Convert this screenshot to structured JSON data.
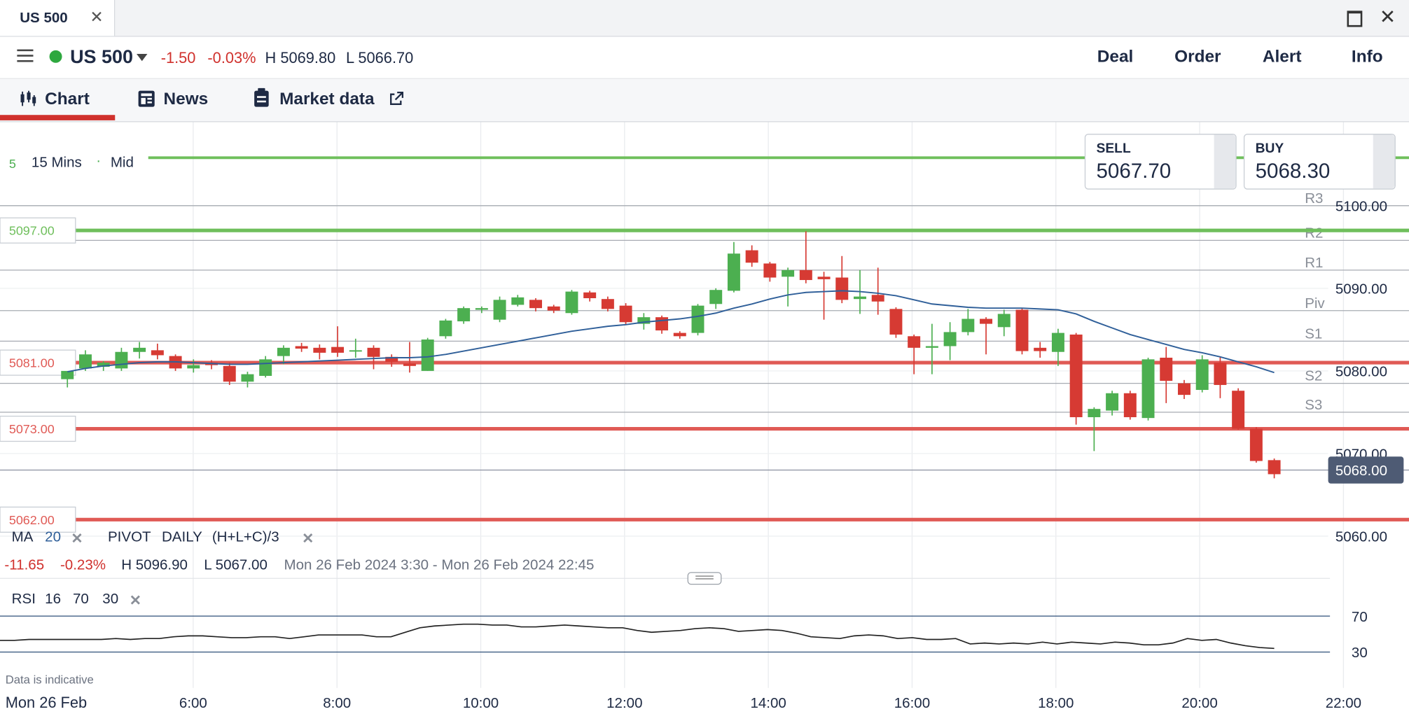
{
  "window": {
    "tab_title": "US 500",
    "close_icon": "close-icon",
    "maximize_icon": "maximize-icon"
  },
  "instrument": {
    "name": "US 500",
    "change": "-1.50",
    "change_pct": "-0.03%",
    "high": "H 5069.80",
    "low": "L 5066.70",
    "status_color": "#2ea83f"
  },
  "actions": [
    "Deal",
    "Order",
    "Alert",
    "Info"
  ],
  "tabs": [
    {
      "label": "Chart",
      "icon": "candlestick-chart-icon",
      "active": true
    },
    {
      "label": "News",
      "icon": "newspaper-icon",
      "active": false
    },
    {
      "label": "Market data",
      "icon": "clipboard-icon",
      "active": false,
      "trailing_icon": "external-link-icon"
    }
  ],
  "toolbar": {
    "interval_prefix": "5",
    "interval": "15 Mins",
    "price_type": "Mid"
  },
  "quotes": {
    "sell": {
      "label": "SELL",
      "price": "5067.70"
    },
    "buy": {
      "label": "BUY",
      "price": "5068.30"
    }
  },
  "indicators": {
    "ma": {
      "name": "MA",
      "period": "20"
    },
    "pivot": {
      "name": "PIVOT",
      "period": "DAILY",
      "formula": "(H+L+C)/3"
    },
    "rsi": {
      "name": "RSI",
      "period": "16",
      "upper": "70",
      "lower": "30"
    }
  },
  "summary": {
    "change": "-11.65",
    "change_pct": "-0.23%",
    "high": "H 5096.90",
    "low": "L 5067.00",
    "range": "Mon 26 Feb 2024 3:30 - Mon 26 Feb 2024 22:45"
  },
  "disclaimer": "Data is indicative",
  "chart_data": {
    "type": "candlestick",
    "date_label": "Mon 26 Feb",
    "x_ticks": [
      "6:00",
      "8:00",
      "10:00",
      "12:00",
      "14:00",
      "16:00",
      "18:00",
      "20:00",
      "22:00"
    ],
    "y_ticks": [
      "5100.00",
      "5090.00",
      "5080.00",
      "5070.00",
      "5060.00"
    ],
    "ylim": [
      5058,
      5110
    ],
    "current_price": "5068.00",
    "candles": [
      [
        5079.0,
        5080.0,
        5078.0,
        5079.5
      ],
      [
        5080.3,
        5082.0,
        5080.0,
        5082.5
      ],
      [
        5080.5,
        5081.0,
        5080.0,
        5081.2
      ],
      [
        5080.3,
        5082.3,
        5080.0,
        5082.8
      ],
      [
        5082.3,
        5082.8,
        5081.5,
        5083.5
      ],
      [
        5082.5,
        5081.9,
        5081.4,
        5083.3
      ],
      [
        5081.8,
        5080.3,
        5080.0,
        5082.0
      ],
      [
        5080.3,
        5080.7,
        5079.8,
        5081.4
      ],
      [
        5081.0,
        5080.7,
        5080.2,
        5081.3
      ],
      [
        5080.6,
        5078.7,
        5078.3,
        5081.0
      ],
      [
        5078.7,
        5079.6,
        5078.0,
        5079.9
      ],
      [
        5079.4,
        5081.4,
        5079.2,
        5081.8
      ],
      [
        5081.8,
        5082.8,
        5080.8,
        5083.1
      ],
      [
        5083.0,
        5082.7,
        5082.3,
        5083.4
      ],
      [
        5082.8,
        5082.2,
        5081.4,
        5083.2
      ],
      [
        5082.9,
        5082.2,
        5081.7,
        5085.4
      ],
      [
        5082.4,
        5082.5,
        5081.6,
        5083.9
      ],
      [
        5082.8,
        5081.7,
        5080.2,
        5083.1
      ],
      [
        5081.7,
        5081.1,
        5080.5,
        5082.0
      ],
      [
        5080.9,
        5080.6,
        5079.8,
        5083.5
      ],
      [
        5080.0,
        5083.8,
        5080.0,
        5084.0
      ],
      [
        5084.2,
        5086.1,
        5083.9,
        5086.3
      ],
      [
        5086.0,
        5087.6,
        5085.7,
        5087.8
      ],
      [
        5087.4,
        5087.6,
        5087.0,
        5087.8
      ],
      [
        5086.2,
        5088.6,
        5085.9,
        5089.0
      ],
      [
        5088.0,
        5088.9,
        5087.8,
        5089.2
      ],
      [
        5088.6,
        5087.6,
        5087.2,
        5088.8
      ],
      [
        5087.8,
        5087.3,
        5087.0,
        5088.0
      ],
      [
        5087.0,
        5089.6,
        5086.8,
        5089.8
      ],
      [
        5089.5,
        5088.8,
        5088.4,
        5089.7
      ],
      [
        5088.7,
        5087.5,
        5087.2,
        5089.0
      ],
      [
        5087.9,
        5085.9,
        5085.6,
        5088.2
      ],
      [
        5085.7,
        5086.5,
        5085.0,
        5087.0
      ],
      [
        5086.5,
        5084.9,
        5084.5,
        5086.7
      ],
      [
        5084.6,
        5084.2,
        5083.9,
        5084.8
      ],
      [
        5084.6,
        5087.9,
        5084.3,
        5088.1
      ],
      [
        5088.1,
        5089.8,
        5087.5,
        5090.0
      ],
      [
        5089.7,
        5094.2,
        5089.5,
        5095.6
      ],
      [
        5094.6,
        5093.1,
        5092.6,
        5095.2
      ],
      [
        5093.0,
        5091.3,
        5090.8,
        5093.2
      ],
      [
        5091.4,
        5092.2,
        5087.8,
        5092.5
      ],
      [
        5092.2,
        5091.0,
        5090.6,
        5096.9
      ],
      [
        5091.4,
        5091.1,
        5086.2,
        5092.0
      ],
      [
        5091.3,
        5088.6,
        5088.2,
        5093.9
      ],
      [
        5088.7,
        5089.0,
        5086.9,
        5092.2
      ],
      [
        5089.2,
        5088.4,
        5086.8,
        5092.5
      ],
      [
        5087.5,
        5084.4,
        5084.0,
        5087.7
      ],
      [
        5084.2,
        5082.8,
        5079.6,
        5084.4
      ],
      [
        5082.8,
        5083.0,
        5079.6,
        5085.7
      ],
      [
        5083.0,
        5084.7,
        5081.3,
        5085.9
      ],
      [
        5084.7,
        5086.3,
        5084.3,
        5087.5
      ],
      [
        5086.3,
        5085.7,
        5082.0,
        5086.5
      ],
      [
        5085.3,
        5086.9,
        5084.2,
        5087.4
      ],
      [
        5087.4,
        5082.4,
        5082.0,
        5087.6
      ],
      [
        5082.8,
        5082.4,
        5081.6,
        5083.5
      ],
      [
        5082.3,
        5084.6,
        5080.6,
        5085.1
      ],
      [
        5084.4,
        5074.4,
        5073.5,
        5084.6
      ],
      [
        5074.4,
        5075.4,
        5070.3,
        5075.6
      ],
      [
        5075.2,
        5077.3,
        5074.6,
        5077.6
      ],
      [
        5077.3,
        5074.4,
        5074.1,
        5077.6
      ],
      [
        5074.3,
        5081.4,
        5074.0,
        5081.6
      ],
      [
        5081.6,
        5078.8,
        5076.1,
        5082.9
      ],
      [
        5078.5,
        5077.1,
        5076.6,
        5078.9
      ],
      [
        5077.7,
        5081.4,
        5077.4,
        5081.9
      ],
      [
        5081.0,
        5078.3,
        5076.7,
        5081.7
      ],
      [
        5077.6,
        5073.0,
        5072.9,
        5077.9
      ],
      [
        5073.0,
        5069.1,
        5068.9,
        5073.2
      ],
      [
        5069.2,
        5067.5,
        5067.0,
        5069.4
      ]
    ],
    "ma_label": "MA 20",
    "ma": [
      5079.9,
      5080.3,
      5080.6,
      5080.8,
      5081.0,
      5081.1,
      5081.1,
      5081.0,
      5080.9,
      5080.8,
      5080.8,
      5080.9,
      5081.0,
      5081.1,
      5081.2,
      5081.3,
      5081.4,
      5081.5,
      5081.6,
      5081.6,
      5081.7,
      5082.0,
      5082.4,
      5082.8,
      5083.2,
      5083.6,
      5084.0,
      5084.4,
      5084.8,
      5085.1,
      5085.4,
      5085.6,
      5085.9,
      5086.1,
      5086.3,
      5086.6,
      5087.0,
      5087.6,
      5088.1,
      5088.7,
      5089.2,
      5089.5,
      5089.6,
      5089.7,
      5089.6,
      5089.4,
      5089.1,
      5088.6,
      5088.1,
      5087.9,
      5087.7,
      5087.6,
      5087.6,
      5087.6,
      5087.5,
      5087.4,
      5086.9,
      5086.0,
      5085.2,
      5084.4,
      5083.8,
      5083.2,
      5082.6,
      5082.2,
      5081.7,
      5081.1,
      5080.5,
      5079.8
    ],
    "pivot_levels": [
      {
        "name": "R3",
        "value": 5100.0
      },
      {
        "name": "R2",
        "value": 5095.8
      },
      {
        "name": "R1",
        "value": 5092.2
      },
      {
        "name": "Piv",
        "value": 5087.3
      },
      {
        "name": "S1",
        "value": 5083.6
      },
      {
        "name": "S2",
        "value": 5078.5
      },
      {
        "name": "S3",
        "value": 5075.0
      }
    ],
    "price_lines": [
      {
        "label": "5097.00",
        "value": 5097.0,
        "color": "#6fbf5c"
      },
      {
        "label": "5081.00",
        "value": 5081.0,
        "color": "#e05a55"
      },
      {
        "label": "5073.00",
        "value": 5073.0,
        "color": "#e05a55"
      },
      {
        "label": "5062.00",
        "value": 5062.0,
        "color": "#e05a55"
      }
    ],
    "top_line": {
      "value": 5105.8,
      "color": "#6fbf5c"
    },
    "rsi": {
      "ylim": [
        20,
        80
      ],
      "ticks": [
        "70",
        "30"
      ],
      "values": [
        43,
        43,
        44,
        44,
        44,
        44,
        44,
        44,
        45,
        44,
        45,
        45,
        47,
        48,
        48,
        47,
        46,
        46,
        47,
        47,
        45,
        47,
        49,
        49,
        49,
        49,
        47,
        47,
        52,
        57,
        59,
        60,
        61,
        61,
        60,
        60,
        58,
        58,
        59,
        60,
        59,
        58,
        57,
        57,
        54,
        52,
        53,
        54,
        56,
        57,
        56,
        53,
        54,
        55,
        54,
        51,
        47,
        46,
        45,
        48,
        49,
        48,
        45,
        46,
        44,
        44,
        45,
        39,
        40,
        39,
        40,
        39,
        41,
        39,
        41,
        40,
        39,
        41,
        40,
        38,
        38,
        40,
        45,
        43,
        44,
        40,
        37,
        35,
        34
      ]
    },
    "colors": {
      "up": "#4caf50",
      "down": "#d63a33",
      "ma": "#2f5f99",
      "rsi": "#222222"
    }
  }
}
